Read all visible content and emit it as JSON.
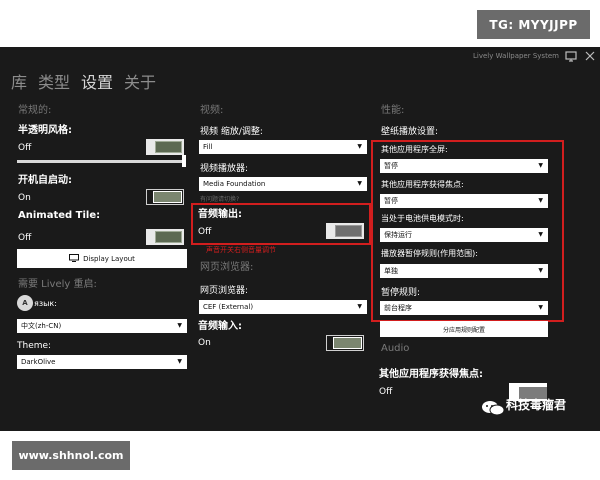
{
  "overlay": {
    "top_badge": "TG: MYYJJPP",
    "bottom_badge": "www.shhnol.com",
    "watermark": "科技毒瘤君"
  },
  "window": {
    "title": "Lively Wallpaper System"
  },
  "nav": {
    "items": [
      "库",
      "类型",
      "设置",
      "关于"
    ]
  },
  "general": {
    "header": "常规的:",
    "transparency_label": "半透明风格:",
    "transparency_state": "Off",
    "startup_label": "开机自启动:",
    "startup_state": "On",
    "animated_tile_label": "Animated Tile:",
    "animated_tile_state": "Off",
    "display_layout_button": "Display Layout",
    "restart_required": "需要 Lively 重启:",
    "language_label": "язык:",
    "language_icon": "A",
    "language_value": "中文(zh-CN)",
    "theme_label": "Theme:",
    "theme_value": "DarkOlive"
  },
  "video": {
    "header": "视频:",
    "scaling_label": "视频 缩放/调整:",
    "scaling_value": "Fill",
    "player_label": "视频播放器:",
    "player_value": "Media Foundation",
    "player_hint": "有问题请切换?",
    "audio_output_label": "音频输出:",
    "audio_output_state": "Off",
    "audio_note": "声音开关右侧音量调节",
    "web_browser_header": "网页浏览器:",
    "browser_label": "网页浏览器:",
    "browser_value": "CEF (External)",
    "audio_input_label": "音频输入:",
    "audio_input_state": "On"
  },
  "performance": {
    "header": "性能:",
    "wallpaper_playback_label": "壁纸播放设置:",
    "fullscreen_label": "其他应用程序全屏:",
    "fullscreen_value": "暂停",
    "focus_label": "其他应用程序获得焦点:",
    "focus_value": "暂停",
    "battery_label": "当处于电池供电模式时:",
    "battery_value": "保持运行",
    "pause_rule_label": "播放器暂停规则(作用范围):",
    "pause_rule_value": "单独",
    "pause_label": "暂停规则:",
    "pause_value": "前台程序",
    "app_rules_button": "分应用规则配置",
    "audio_header": "Audio",
    "audio_focus_label": "其他应用程序获得焦点:",
    "audio_focus_state": "Off"
  },
  "colors": {
    "background": "#1a1a1a",
    "accent_olive": "#5c6952",
    "annotation_red": "#d21e1e"
  }
}
